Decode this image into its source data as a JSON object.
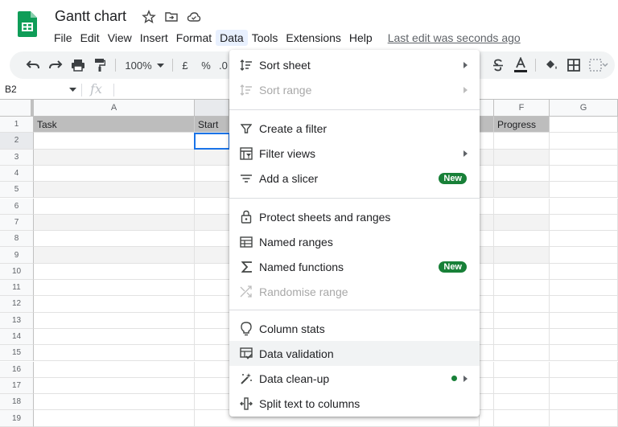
{
  "title": "Gantt chart",
  "menubar": [
    "File",
    "Edit",
    "View",
    "Insert",
    "Format",
    "Data",
    "Tools",
    "Extensions",
    "Help"
  ],
  "last_edit": "Last edit was seconds ago",
  "toolbar": {
    "zoom": "100%",
    "currency": "£",
    "percent": "%",
    "decimal": ".0"
  },
  "formula_bar": {
    "name_box": "B2",
    "fx": "fx"
  },
  "grid": {
    "columns": [
      "A",
      "",
      "",
      "",
      "",
      "F",
      "G"
    ],
    "header_row": [
      "Task",
      "Start",
      "",
      "",
      "",
      "Progress",
      ""
    ],
    "row_numbers": [
      "1",
      "2",
      "3",
      "4",
      "5",
      "6",
      "7",
      "8",
      "9",
      "10",
      "11",
      "12",
      "13",
      "14",
      "15",
      "16",
      "17",
      "18",
      "19"
    ]
  },
  "data_menu": {
    "items": [
      {
        "label": "Sort sheet",
        "icon": "sort-icon",
        "submenu": true,
        "disabled": false
      },
      {
        "label": "Sort range",
        "icon": "sort-icon",
        "submenu": true,
        "disabled": true
      },
      {
        "label": "Create a filter",
        "icon": "filter-icon",
        "submenu": false,
        "disabled": false
      },
      {
        "label": "Filter views",
        "icon": "filter-views-icon",
        "submenu": true,
        "disabled": false
      },
      {
        "label": "Add a slicer",
        "icon": "slicer-icon",
        "badge": "New",
        "disabled": false
      },
      {
        "label": "Protect sheets and ranges",
        "icon": "lock-icon",
        "disabled": false
      },
      {
        "label": "Named ranges",
        "icon": "named-ranges-icon",
        "disabled": false
      },
      {
        "label": "Named functions",
        "icon": "sigma-icon",
        "badge": "New",
        "disabled": false
      },
      {
        "label": "Randomise range",
        "icon": "shuffle-icon",
        "disabled": true
      },
      {
        "label": "Column stats",
        "icon": "lightbulb-icon",
        "disabled": false
      },
      {
        "label": "Data validation",
        "icon": "data-validation-icon",
        "disabled": false
      },
      {
        "label": "Data clean-up",
        "icon": "magic-wand-icon",
        "submenu": true,
        "disabled": false
      },
      {
        "label": "Split text to columns",
        "icon": "split-columns-icon",
        "disabled": false
      }
    ]
  },
  "colors": {
    "accent_green": "#188038",
    "sheets_green": "#0f9d58",
    "header_gray": "#bdbdbd",
    "band_gray": "#f3f3f3",
    "selection_blue": "#1a73e8"
  }
}
